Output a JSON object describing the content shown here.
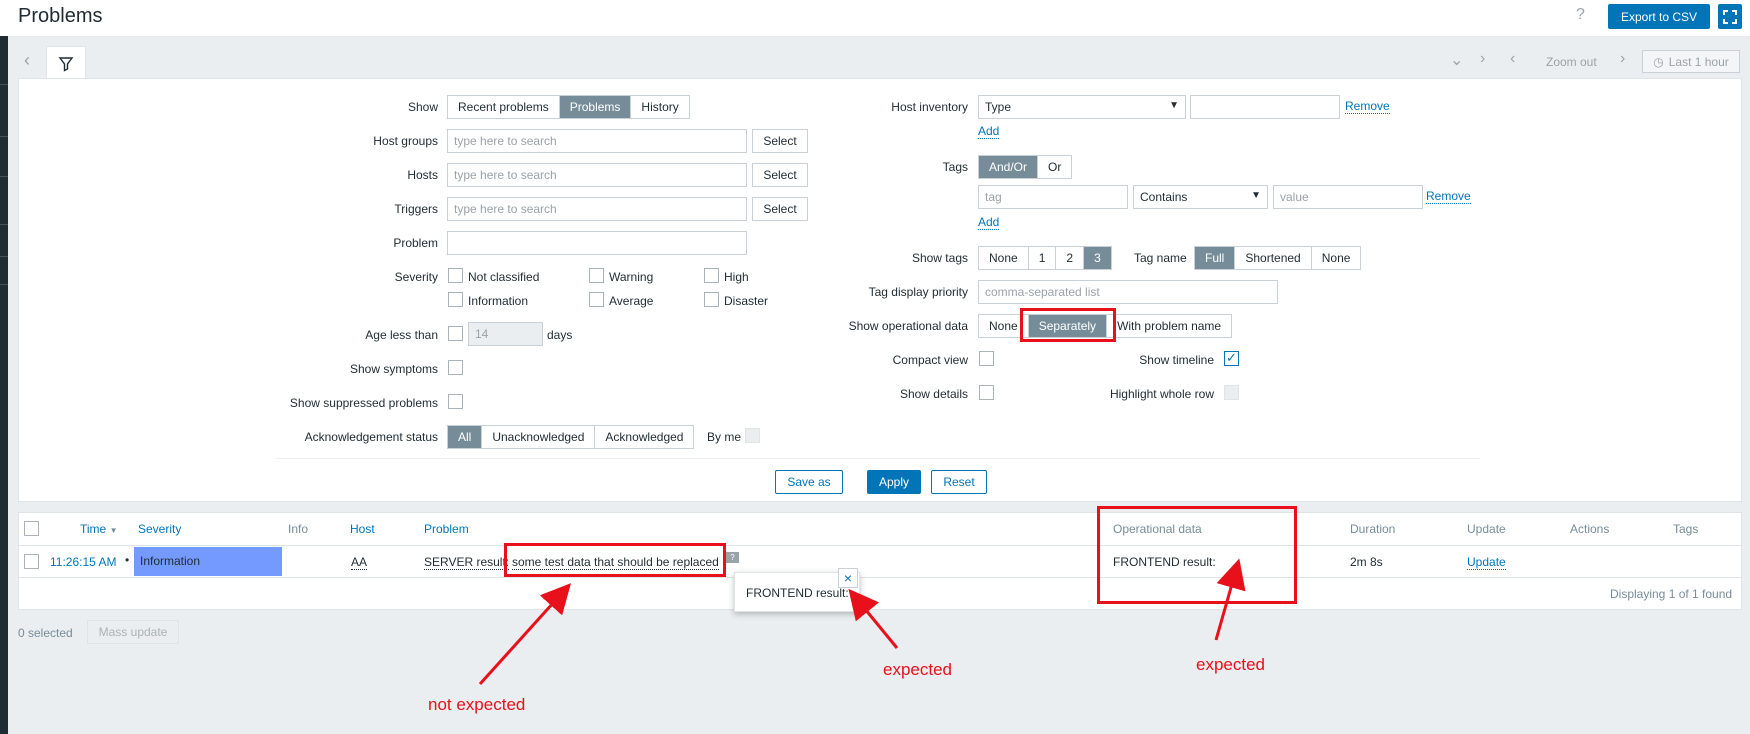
{
  "header": {
    "title": "Problems",
    "help": "?",
    "export_label": "Export to CSV",
    "kiosk_icon": "kiosk-mode-icon"
  },
  "toolbar": {
    "zoom_out": "Zoom out",
    "last_hour": "Last 1 hour"
  },
  "filter": {
    "show_label": "Show",
    "show_options": [
      "Recent problems",
      "Problems",
      "History"
    ],
    "show_selected": "Problems",
    "host_groups_label": "Host groups",
    "hosts_label": "Hosts",
    "triggers_label": "Triggers",
    "search_placeholder": "type here to search",
    "select_label": "Select",
    "problem_label": "Problem",
    "severity_label": "Severity",
    "severities": [
      "Not classified",
      "Warning",
      "High",
      "Information",
      "Average",
      "Disaster"
    ],
    "age_label": "Age less than",
    "age_value": "14",
    "age_unit": "days",
    "show_symptoms_label": "Show symptoms",
    "show_suppressed_label": "Show suppressed problems",
    "ack_label": "Acknowledgement status",
    "ack_options": [
      "All",
      "Unacknowledged",
      "Acknowledged"
    ],
    "ack_selected": "All",
    "by_me_label": "By me",
    "host_inventory_label": "Host inventory",
    "inventory_type": "Type",
    "remove_label": "Remove",
    "add_label": "Add",
    "tags_label": "Tags",
    "tags_options": [
      "And/Or",
      "Or"
    ],
    "tags_selected": "And/Or",
    "tag_placeholder": "tag",
    "tag_operator": "Contains",
    "value_placeholder": "value",
    "show_tags_label": "Show tags",
    "show_tags_options": [
      "None",
      "1",
      "2",
      "3"
    ],
    "show_tags_selected": "3",
    "tag_name_label": "Tag name",
    "tag_name_options": [
      "Full",
      "Shortened",
      "None"
    ],
    "tag_name_selected": "Full",
    "tag_priority_label": "Tag display priority",
    "tag_priority_placeholder": "comma-separated list",
    "opdata_label": "Show operational data",
    "opdata_options": [
      "None",
      "Separately",
      "With problem name"
    ],
    "opdata_selected": "Separately",
    "compact_label": "Compact view",
    "timeline_label": "Show timeline",
    "details_label": "Show details",
    "highlight_label": "Highlight whole row",
    "save_as": "Save as",
    "apply": "Apply",
    "reset": "Reset"
  },
  "table": {
    "headers": {
      "time": "Time",
      "sort_indicator": "▼",
      "severity": "Severity",
      "info": "Info",
      "host": "Host",
      "problem": "Problem",
      "opdata": "Operational data",
      "duration": "Duration",
      "update": "Update",
      "actions": "Actions",
      "tags": "Tags"
    },
    "rows": [
      {
        "time": "11:26:15 AM",
        "severity": "Information",
        "severity_color": "#7499ff",
        "host": "AA",
        "problem_prefix": "SERVER result:",
        "problem_data": "some test data that should be replaced",
        "opdata": "FRONTEND result:",
        "duration": "2m 8s",
        "update": "Update"
      }
    ],
    "displaying": "Displaying 1 of 1 found"
  },
  "popup": {
    "text": "FRONTEND result:"
  },
  "footer": {
    "selected": "0 selected",
    "mass_update": "Mass update"
  },
  "annotations": {
    "not_expected": "not expected",
    "expected_1": "expected",
    "expected_2": "expected",
    "color": "#e8101a"
  }
}
